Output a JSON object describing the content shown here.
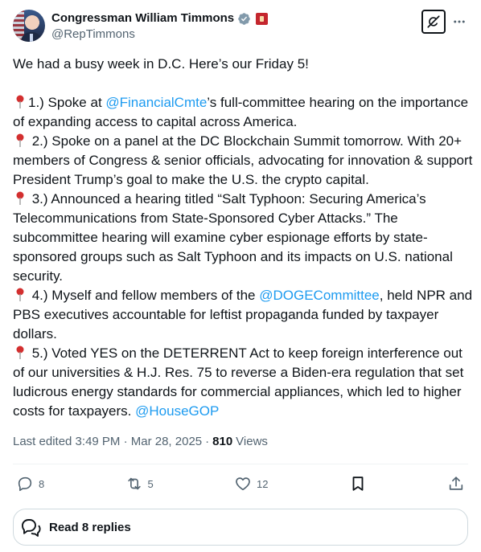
{
  "author": {
    "display_name": "Congressman William Timmons",
    "handle": "@RepTimmons",
    "avatar_icon": "profile-photo",
    "verified_icon": "verified-badge-gray",
    "affiliation_icon": "government-badge"
  },
  "header": {
    "grok_icon": "grok-icon",
    "more_icon": "more-horizontal-icon"
  },
  "tweet": {
    "intro": "We had a busy week in D.C. Here’s our Friday 5!",
    "items": [
      {
        "prefix": "1.) Spoke at ",
        "mention": "@FinancialCmte",
        "suffix": "’s full-committee hearing on the importance of expanding access to capital across America."
      },
      {
        "prefix": " 2.) Spoke on a panel at the DC Blockchain Summit tomorrow. With 20+ members of Congress & senior officials, advocating for innovation & support President Trump’s goal to make the U.S. the crypto capital.",
        "mention": "",
        "suffix": ""
      },
      {
        "prefix": " 3.) Announced a hearing titled “Salt Typhoon: Securing America’s Telecommunications from State-Sponsored Cyber Attacks.” The subcommittee hearing will examine cyber espionage efforts by state-sponsored groups such as Salt Typhoon and its impacts on U.S. national security.",
        "mention": "",
        "suffix": ""
      },
      {
        "prefix": " 4.) Myself and fellow members of the ",
        "mention": "@DOGECommittee",
        "suffix": ", held NPR and PBS executives accountable for leftist propaganda funded by taxpayer dollars."
      },
      {
        "prefix": " 5.) Voted YES on the DETERRENT Act to keep foreign interference out of our universities & H.J. Res. 75 to reverse a Biden-era regulation that set ludicrous energy standards for commercial appliances, which led to higher costs for taxpayers. ",
        "mention": "@HouseGOP",
        "suffix": ""
      }
    ],
    "pin_icon": "round-pushpin-icon"
  },
  "meta": {
    "edited_label": "Last edited 3:49 PM · Mar 28, 2025",
    "separator": "·",
    "views_count": "810",
    "views_label": "Views"
  },
  "actions": {
    "replies": "8",
    "reposts": "5",
    "likes": "12",
    "bookmark_icon": "bookmark-icon",
    "share_icon": "share-icon"
  },
  "read_replies": {
    "label": "Read 8 replies",
    "icon": "chat-bubbles-icon"
  },
  "colors": {
    "link": "#1d9bf0",
    "text": "#0f1419",
    "secondary": "#536471",
    "border": "#cfd9de",
    "pin_red": "#d32f2f"
  }
}
